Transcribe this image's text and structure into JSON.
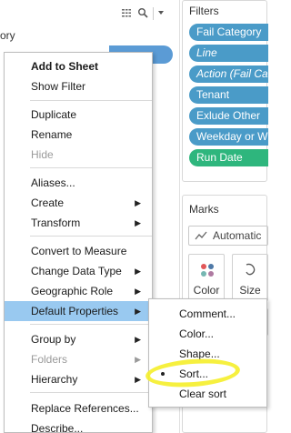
{
  "left_pane": {
    "field_label": "ory",
    "toolbar_icons": [
      "grid-icon",
      "search-icon",
      "dropdown-icon"
    ]
  },
  "filters": {
    "title": "Filters",
    "items": [
      {
        "label": "Fail Category",
        "color": "#4a9bc8",
        "italic": false
      },
      {
        "label": "Line",
        "color": "#4a9bc8",
        "italic": true
      },
      {
        "label": "Action (Fail Ca",
        "color": "#4a9bc8",
        "italic": true
      },
      {
        "label": "Tenant",
        "color": "#4a9bc8",
        "italic": false
      },
      {
        "label": "Exlude Other",
        "color": "#4a9bc8",
        "italic": false
      },
      {
        "label": "Weekday or W",
        "color": "#4a9bc8",
        "italic": false
      },
      {
        "label": "Run Date",
        "color": "#2eb67d",
        "italic": false
      }
    ]
  },
  "marks": {
    "title": "Marks",
    "mark_type": "Automatic",
    "buttons": {
      "color": "Color",
      "size": "Size"
    }
  },
  "context_menu": {
    "items": [
      {
        "label": "Add to Sheet",
        "bold": true
      },
      {
        "label": "Show Filter"
      },
      {
        "label": "Duplicate"
      },
      {
        "label": "Rename"
      },
      {
        "label": "Hide",
        "disabled": true
      },
      {
        "label": "Aliases..."
      },
      {
        "label": "Create",
        "submenu": true
      },
      {
        "label": "Transform",
        "submenu": true
      },
      {
        "label": "Convert to Measure"
      },
      {
        "label": "Change Data Type",
        "submenu": true
      },
      {
        "label": "Geographic Role",
        "submenu": true
      },
      {
        "label": "Default Properties",
        "submenu": true,
        "highlighted": true
      },
      {
        "label": "Group by",
        "submenu": true
      },
      {
        "label": "Folders",
        "submenu": true,
        "disabled": true
      },
      {
        "label": "Hierarchy",
        "submenu": true
      },
      {
        "label": "Replace References..."
      },
      {
        "label": "Describe..."
      }
    ]
  },
  "submenu": {
    "items": [
      {
        "label": "Comment..."
      },
      {
        "label": "Color..."
      },
      {
        "label": "Shape..."
      },
      {
        "label": "Sort...",
        "checked": true
      },
      {
        "label": "Clear sort"
      }
    ]
  },
  "colors": {
    "highlight": "#99c9f0",
    "pill_blue": "#4a9bc8",
    "pill_green": "#2eb67d",
    "annotation_yellow": "#f5ee2a"
  }
}
